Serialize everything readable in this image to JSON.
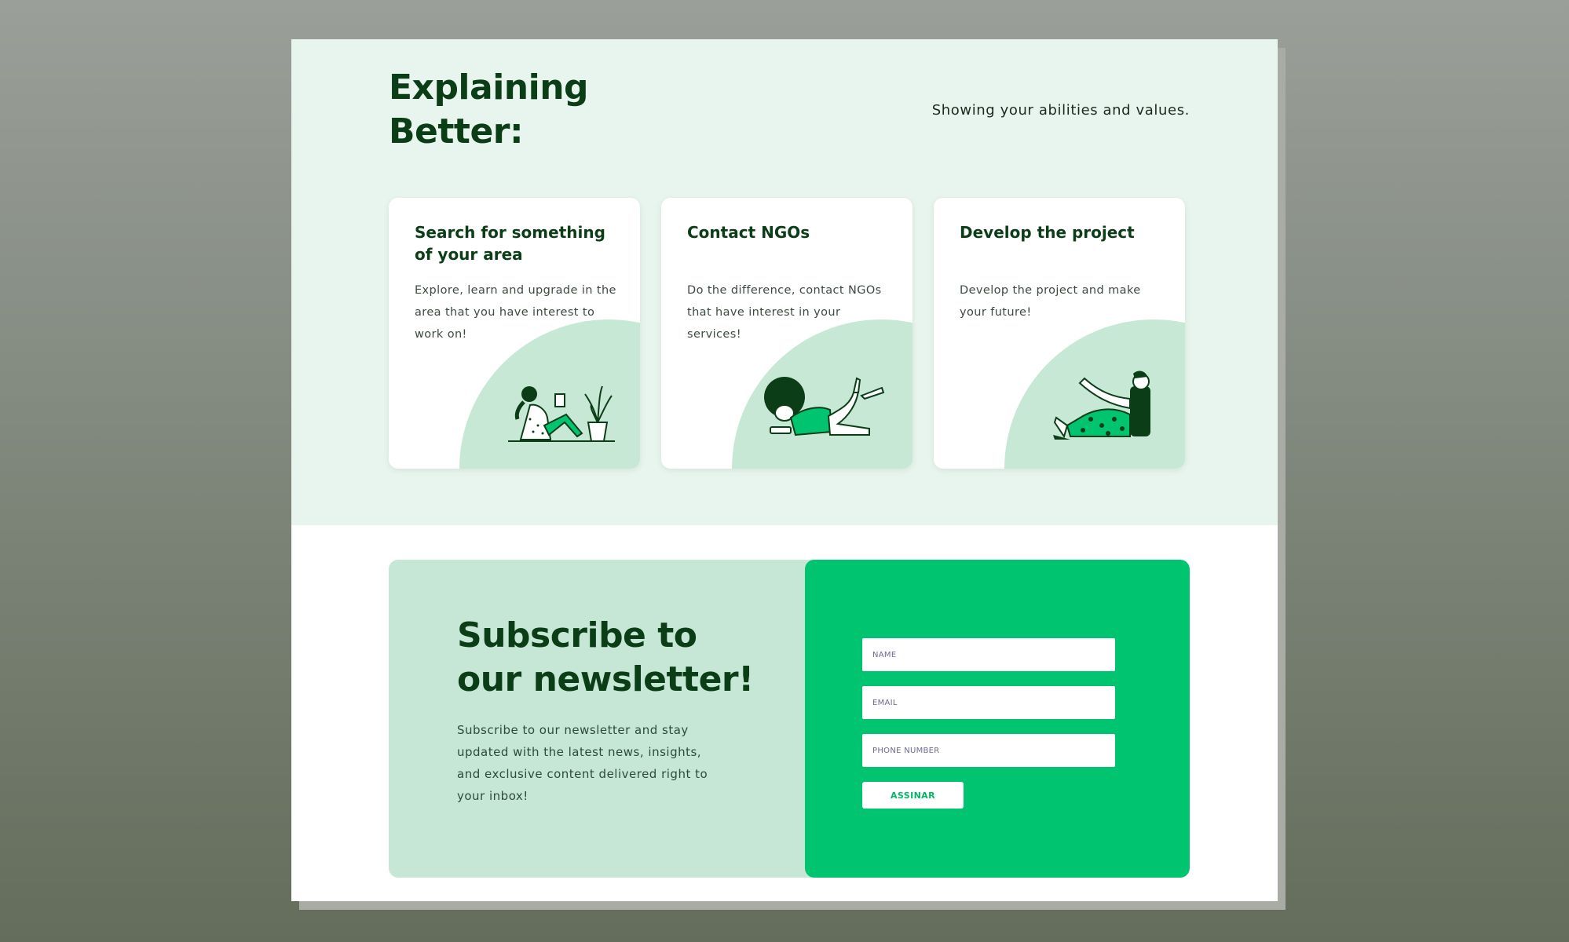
{
  "hero": {
    "title": "Explaining Better:",
    "subtitle": "Showing your abilities and values."
  },
  "cards": [
    {
      "title": "Search for something of your  area",
      "text": "Explore, learn and upgrade in the area that you have interest to work on!",
      "illustration": "woman-reading-with-plant"
    },
    {
      "title": "Contact NGOs",
      "text": "Do the difference, contact NGOs that have interest in your services!",
      "illustration": "person-lying-on-phone"
    },
    {
      "title": "Develop the project",
      "text": "Develop the project and make your future!",
      "illustration": "person-stretching"
    }
  ],
  "newsletter": {
    "title": "Subscribe to our newsletter!",
    "text": "Subscribe to our newsletter and stay updated with the latest news, insights, and exclusive content delivered right to your inbox!",
    "name_placeholder": "NAME",
    "email_placeholder": "EMAIL",
    "phone_placeholder": "PHONE NUMBER",
    "submit_label": "ASSINAR"
  },
  "colors": {
    "dark_green": "#0b3d17",
    "hero_bg": "#e8f5ee",
    "accent_green": "#00c46f",
    "mint": "#c6e7d5"
  }
}
